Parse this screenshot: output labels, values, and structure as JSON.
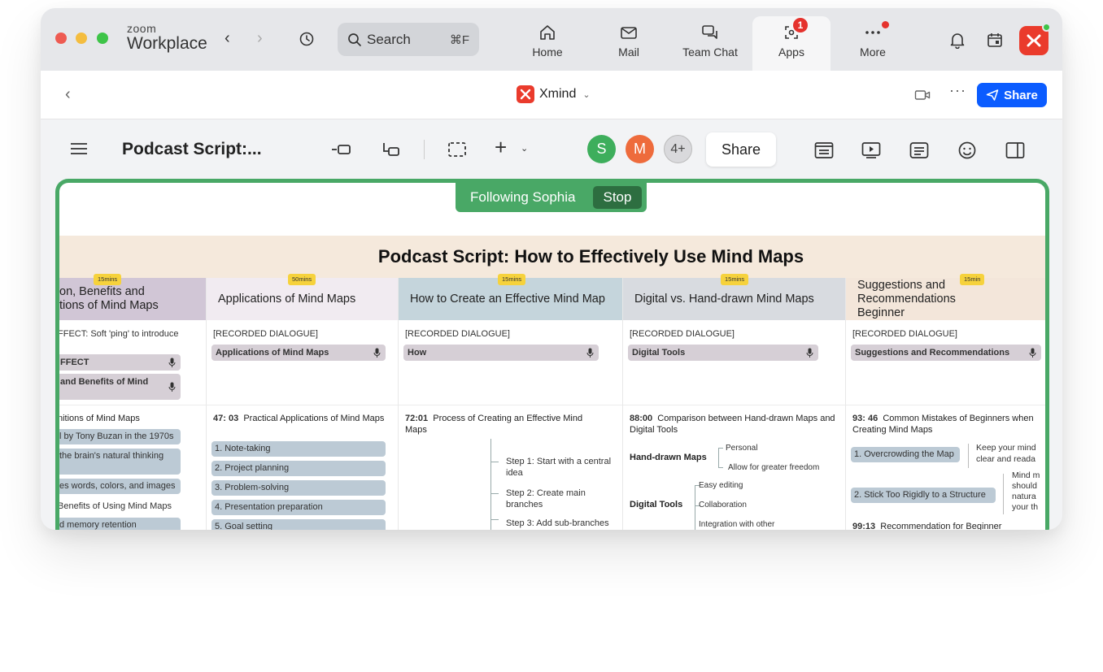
{
  "zoom": {
    "brand_top": "zoom",
    "brand_bottom": "Workplace",
    "search_label": "Search",
    "search_shortcut": "⌘F",
    "nav": [
      {
        "label": "Home"
      },
      {
        "label": "Mail"
      },
      {
        "label": "Team Chat"
      },
      {
        "label": "Apps",
        "badge": "1"
      },
      {
        "label": "More"
      }
    ],
    "accent": "#0b5cff",
    "badge_color": "#e5322d"
  },
  "appbar": {
    "title": "Xmind",
    "share_label": "Share"
  },
  "toolbar": {
    "doc_title": "Podcast Script:...",
    "avatars": [
      "S",
      "M",
      "4+"
    ],
    "share_label": "Share"
  },
  "canvas": {
    "following_label": "Following Sophia",
    "stop_label": "Stop",
    "board_title": "Podcast Script: How to Effectively Use Mind Maps",
    "frame_color": "#49a866",
    "columns": [
      {
        "title": "on, Benefits and\ntions of Mind Maps",
        "duration": "15mins",
        "recorded": "FFECT: Soft 'ping' to introduce",
        "pill1": "FFECT",
        "pill2": "and Benefits of Mind",
        "section_head": "nitions of Mind Maps",
        "items": [
          "l by Tony Buzan in the 1970s",
          "the brain's natural thinking",
          "es words, colors, and images",
          "Benefits of Using Mind Maps",
          "d memory retention"
        ]
      },
      {
        "title": "Applications of Mind Maps",
        "duration": "50mins",
        "recorded": "[RECORDED DIALOGUE]",
        "pill1": "Applications of Mind Maps",
        "section_time": "47: 03",
        "section_head": "Practical Applications of Mind Maps",
        "items": [
          "1. Note-taking",
          "2. Project planning",
          "3. Problem-solving",
          "4. Presentation preparation",
          "5. Goal setting"
        ]
      },
      {
        "title": "How to Create an Effective Mind Map",
        "duration": "15mins",
        "recorded": "[RECORDED DIALOGUE]",
        "pill1": "How",
        "section_time": "72:01",
        "section_head": "Process of Creating an Effective Mind Maps",
        "steps": [
          "Step 1: Start with a central idea",
          "Step 2: Create main branches",
          "Step 3: Add sub-branches"
        ]
      },
      {
        "title": "Digital vs. Hand-drawn Mind Maps",
        "duration": "15mins",
        "recorded": "[RECORDED DIALOGUE]",
        "pill1": "Digital Tools",
        "section_time": "88:00",
        "section_head": "Comparison between Hand-drawn Maps and Digital Tools",
        "group1": "Hand-drawn Maps",
        "group1_items": [
          "Personal",
          "Allow for greater freedom"
        ],
        "group2": "Digital Tools",
        "group2_items": [
          "Easy editing",
          "Collaboration",
          "Integration with other"
        ]
      },
      {
        "title": "Suggestions and Recommendations\nBeginner",
        "duration": "15min",
        "recorded": "[RECORDED DIALOGUE]",
        "pill1": "Suggestions and Recommendations",
        "section_time": "93: 46",
        "section_head": "Common Mistakes of Beginners when Creating Mind Maps",
        "items": [
          "1. Overcrowding the Map",
          "2. Stick Too Rigidly to a Structure"
        ],
        "notes1": "Keep your mind\nclear and reada",
        "notes2": "Mind m\nshould\nnatura\nyour th",
        "next_time": "99:13",
        "next_head": "Recommendation for Beginner"
      }
    ]
  }
}
